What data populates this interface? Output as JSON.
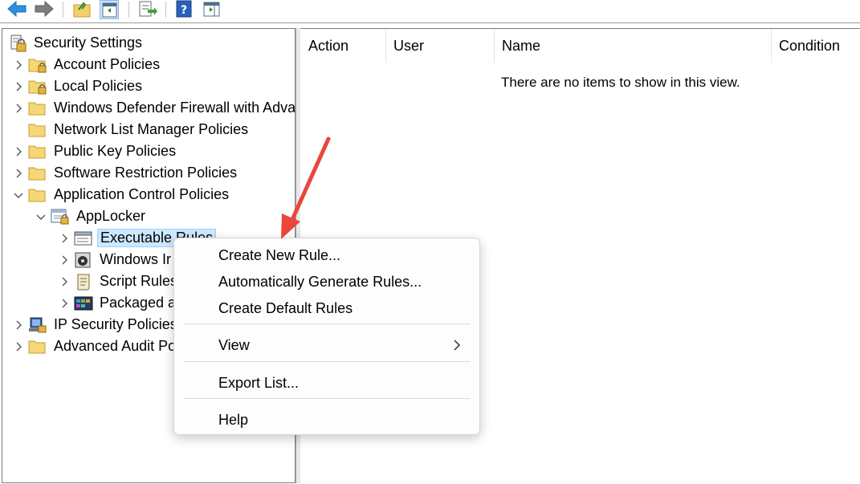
{
  "toolbar": {
    "buttons": [
      "back-icon",
      "forward-icon",
      "up-folder-icon",
      "show-hide-tree-icon",
      "export-list-icon",
      "help-icon",
      "show-hide-action-pane-icon"
    ]
  },
  "tree": {
    "root": "Security Settings",
    "items": [
      {
        "label": "Account Policies"
      },
      {
        "label": "Local Policies"
      },
      {
        "label": "Windows Defender Firewall with Advar"
      },
      {
        "label": "Network List Manager Policies"
      },
      {
        "label": "Public Key Policies"
      },
      {
        "label": "Software Restriction Policies"
      },
      {
        "label": "Application Control Policies"
      },
      {
        "label": "AppLocker"
      },
      {
        "label": "Executable Rules"
      },
      {
        "label": "Windows Ir"
      },
      {
        "label": "Script Rules"
      },
      {
        "label": "Packaged a"
      },
      {
        "label": "IP Security Policies"
      },
      {
        "label": "Advanced Audit Po"
      }
    ]
  },
  "list": {
    "columns": [
      "Action",
      "User",
      "Name",
      "Condition"
    ],
    "empty_message": "There are no items to show in this view."
  },
  "context_menu": {
    "items": [
      "Create New Rule...",
      "Automatically Generate Rules...",
      "Create Default Rules",
      "View",
      "Export List...",
      "Help"
    ]
  },
  "colors": {
    "selection_bg": "#cce8ff",
    "annotation_arrow": "#e8473c"
  }
}
